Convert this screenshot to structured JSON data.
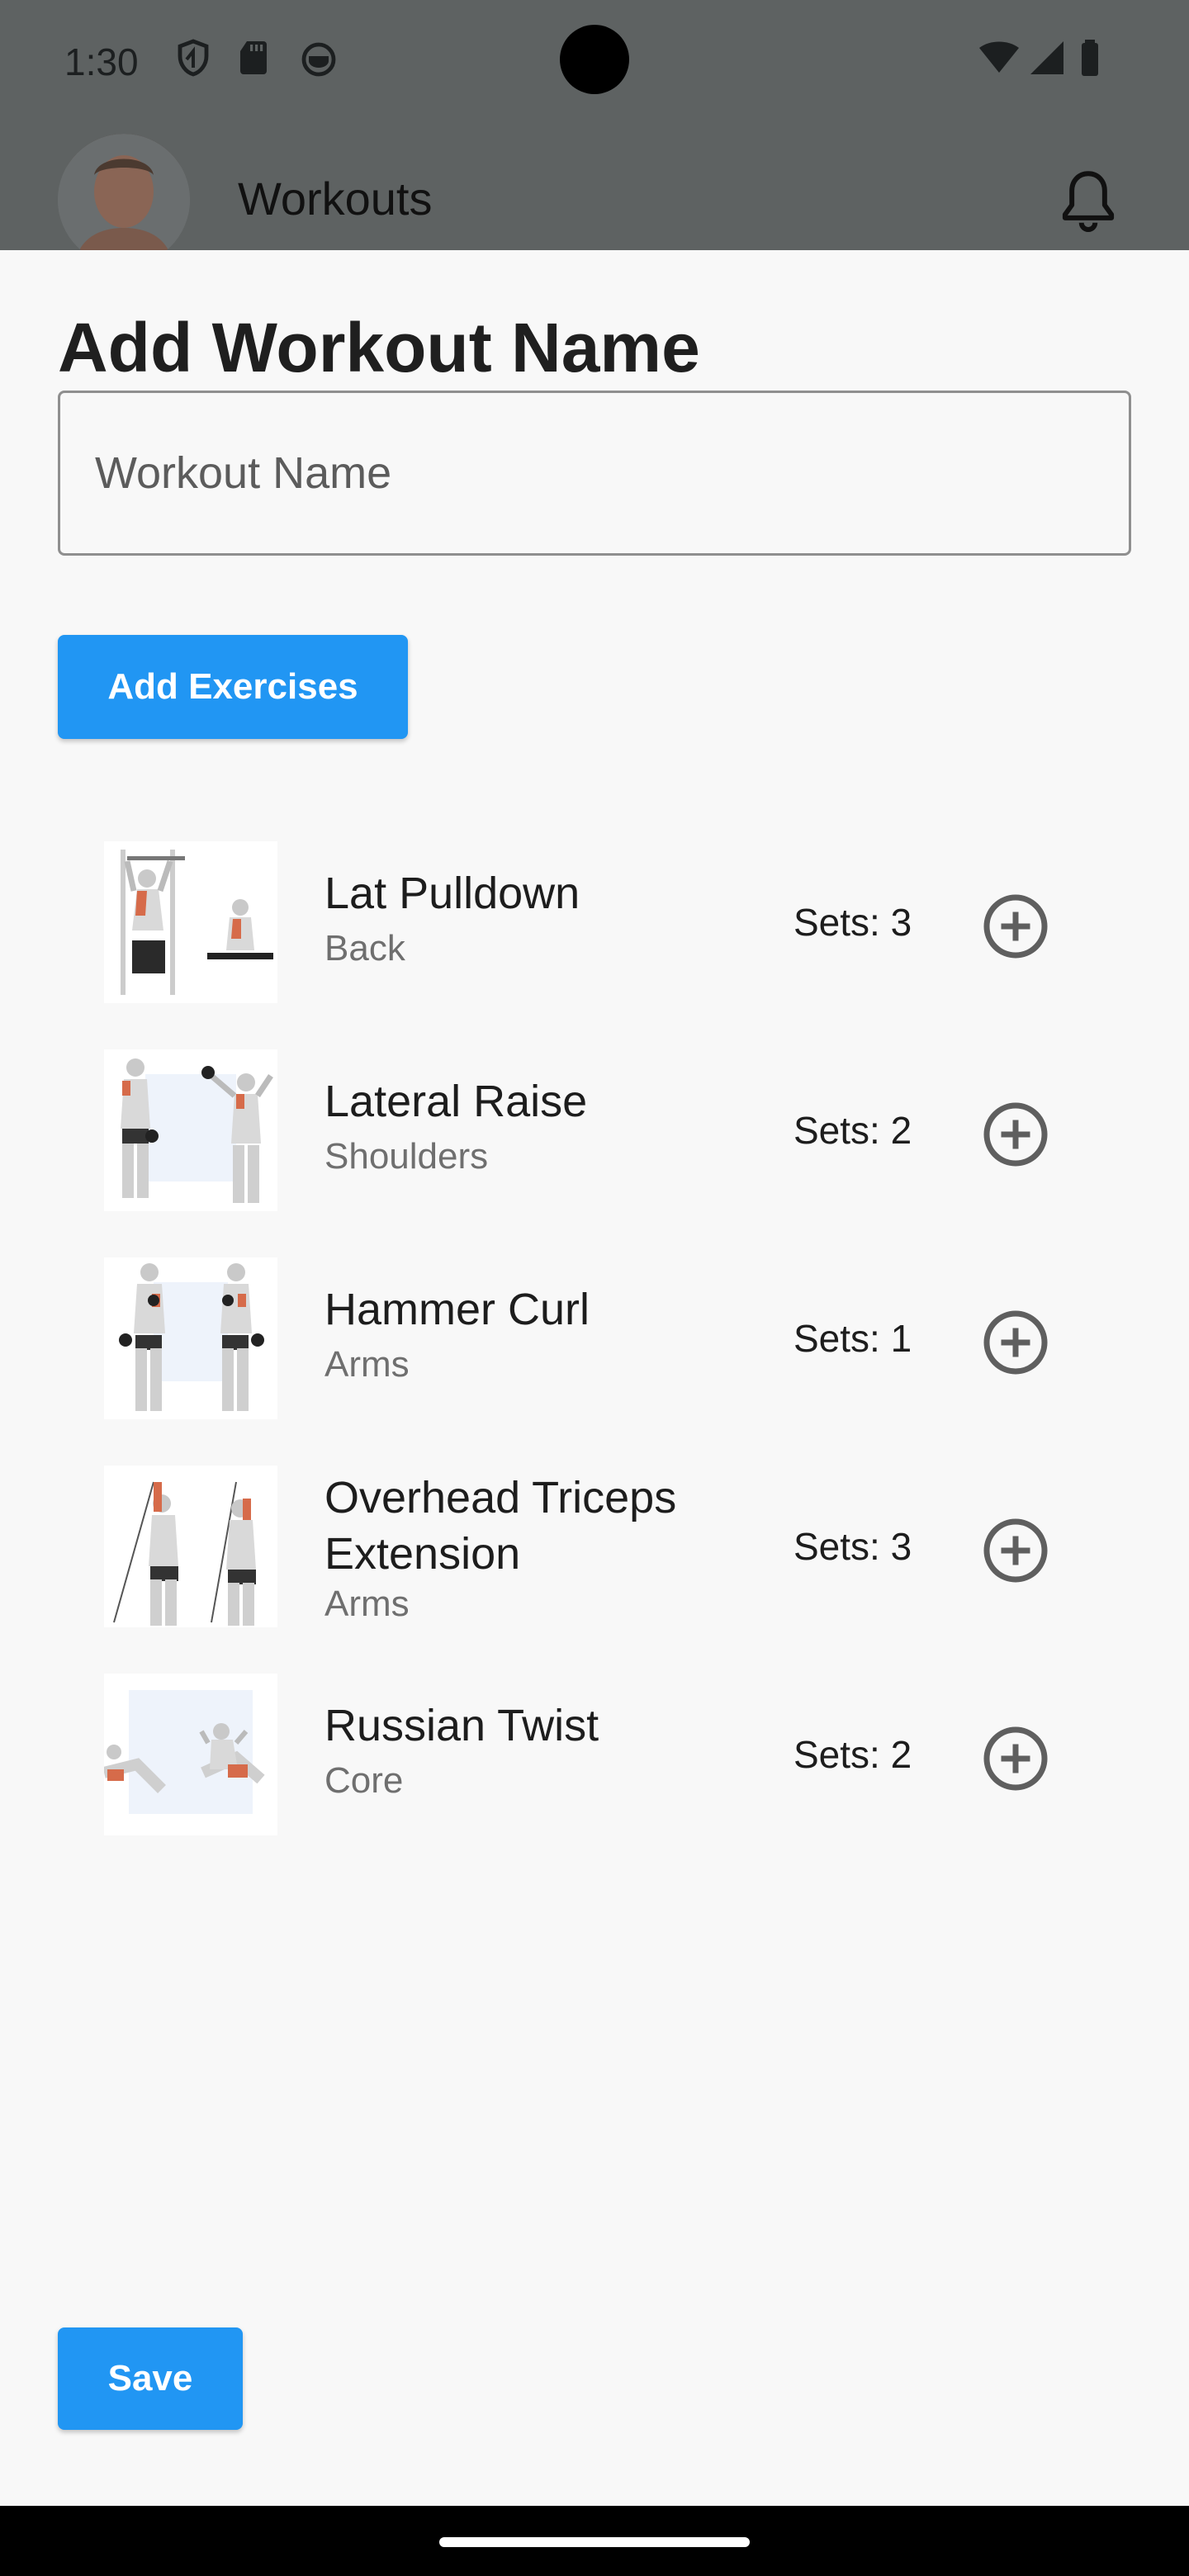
{
  "status": {
    "time": "1:30"
  },
  "header": {
    "title": "Workouts"
  },
  "sheet": {
    "title": "Add Workout Name",
    "input_placeholder": "Workout Name",
    "add_exercises_label": "Add Exercises",
    "save_label": "Save"
  },
  "exercises": [
    {
      "name": "Lat Pulldown",
      "category": "Back",
      "sets": "Sets: 3"
    },
    {
      "name": "Lateral Raise",
      "category": "Shoulders",
      "sets": "Sets: 2"
    },
    {
      "name": "Hammer Curl",
      "category": "Arms",
      "sets": "Sets: 1"
    },
    {
      "name": "Overhead Triceps Extension",
      "category": "Arms",
      "sets": "Sets: 3"
    },
    {
      "name": "Russian Twist",
      "category": "Core",
      "sets": "Sets: 2"
    }
  ],
  "colors": {
    "accent": "#2196f3",
    "scrim": "#5e6262",
    "sheet": "#f8f8f8"
  },
  "icons": [
    "shield-icon",
    "sd-card-icon",
    "cat-icon",
    "wifi-icon",
    "signal-icon",
    "battery-icon",
    "bell-icon",
    "add-circle-icon"
  ]
}
